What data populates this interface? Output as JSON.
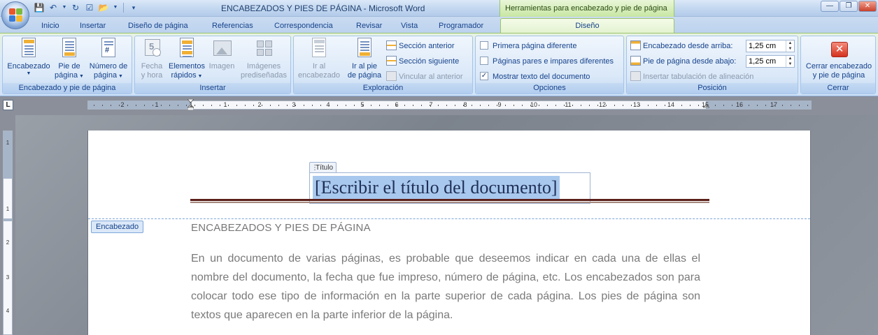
{
  "window": {
    "title": "ENCABEZADOS Y PIES DE PÁGINA - Microsoft Word",
    "context_tab_title": "Herramientas para encabezado y pie de página",
    "controls": [
      "—",
      "❐",
      "✕"
    ]
  },
  "quick_access": {
    "icons": [
      "word-app-icon",
      "save-icon",
      "undo-icon",
      "redo-icon",
      "folder-icon",
      "dropdown-icon"
    ]
  },
  "tabs": [
    {
      "label": "Inicio"
    },
    {
      "label": "Insertar"
    },
    {
      "label": "Diseño de página"
    },
    {
      "label": "Referencias"
    },
    {
      "label": "Correspondencia"
    },
    {
      "label": "Revisar"
    },
    {
      "label": "Vista"
    },
    {
      "label": "Programador"
    },
    {
      "label": "Diseño",
      "active": true
    }
  ],
  "ribbon": {
    "groups": {
      "header_footer": {
        "label": "Encabezado y pie de página",
        "encabezado": {
          "line1": "Encabezado",
          "line2": ""
        },
        "pie": {
          "line1": "Pie de",
          "line2": "página"
        },
        "numero": {
          "line1": "Número de",
          "line2": "página"
        }
      },
      "insert": {
        "label": "Insertar",
        "fecha": {
          "line1": "Fecha",
          "line2": "y hora"
        },
        "elementos": {
          "line1": "Elementos",
          "line2": "rápidos"
        },
        "imagen": {
          "line1": "Imagen",
          "line2": ""
        },
        "imagenes": {
          "line1": "Imágenes",
          "line2": "prediseñadas"
        }
      },
      "navigation": {
        "label": "Exploración",
        "ir_encabezado": {
          "line1": "Ir al",
          "line2": "encabezado"
        },
        "ir_pie": {
          "line1": "Ir al pie",
          "line2": "de página"
        },
        "seccion_anterior": "Sección anterior",
        "seccion_siguiente": "Sección siguiente",
        "vincular": "Vincular al anterior"
      },
      "options": {
        "label": "Opciones",
        "primera": {
          "label": "Primera página diferente",
          "checked": false
        },
        "pares": {
          "label": "Páginas pares e impares diferentes",
          "checked": false
        },
        "mostrar": {
          "label": "Mostrar texto del documento",
          "checked": true
        }
      },
      "position": {
        "label": "Posición",
        "encabezado_arriba": {
          "label": "Encabezado desde arriba:",
          "value": "1,25 cm"
        },
        "pie_abajo": {
          "label": "Pie de página desde abajo:",
          "value": "1,25 cm"
        },
        "tabulacion": "Insertar tabulación de alineación"
      },
      "close": {
        "label": "Cerrar",
        "button": {
          "line1": "Cerrar encabezado",
          "line2": "y pie de página"
        }
      }
    }
  },
  "ruler": {
    "tab_selector": "L",
    "numbers": [
      "2",
      "1",
      "1",
      "1",
      "2",
      "3",
      "4",
      "5",
      "6",
      "7",
      "8",
      "9",
      "10",
      "11",
      "12",
      "13",
      "14",
      "15",
      "16",
      "17"
    ],
    "vertical_numbers": [
      "1",
      "1",
      "2",
      "3",
      "4"
    ]
  },
  "document": {
    "title_control_tag": "Título",
    "title_placeholder": "[Escribir el título del documento]",
    "header_badge": "Encabezado",
    "heading": "ENCABEZADOS Y PIES DE PÁGINA",
    "paragraph": "En un documento de varias páginas, es probable que deseemos indicar en cada una de ellas el nombre del documento, la fecha que fue impreso, número de página, etc. Los encabezados son para colocar todo ese tipo de información en la parte superior de cada página. Los pies de página son textos que aparecen en la parte inferior de la página."
  }
}
